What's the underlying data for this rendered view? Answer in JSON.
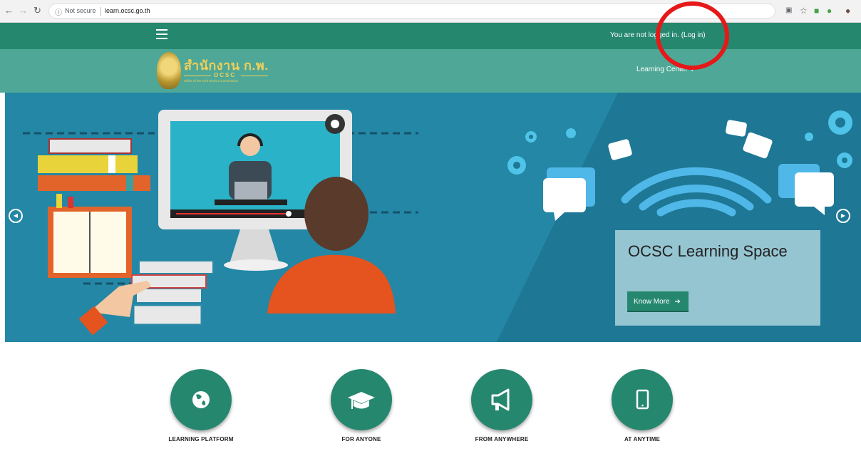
{
  "browser": {
    "back_icon": "arrow-left-icon",
    "forward_icon": "arrow-right-icon",
    "reload_icon": "reload-icon",
    "security_label": "Not secure",
    "url": "learn.ocsc.go.th"
  },
  "topbar": {
    "login_text": "You are not logged in. (",
    "login_link": "Log in",
    "login_close": ")"
  },
  "header": {
    "logo_thai": "สำนักงาน ก.พ.",
    "logo_ocsc": "OCSC",
    "logo_sub": "Office of the Civil Service Commission",
    "learning_center": "Learning Center"
  },
  "carousel": {
    "caption_title": "OCSC Learning Space",
    "know_more": "Know More"
  },
  "features": [
    {
      "label": "LEARNING PLATFORM",
      "icon": "globe-icon"
    },
    {
      "label": "FOR ANYONE",
      "icon": "graduation-cap-icon"
    },
    {
      "label": "FROM ANYWHERE",
      "icon": "megaphone-icon"
    },
    {
      "label": "AT ANYTIME",
      "icon": "mobile-phone-icon"
    }
  ],
  "colors": {
    "topbar": "#26876f",
    "header": "#4fa897",
    "carousel": "#1f7f9c",
    "accent": "#26876f",
    "annotation": "#e51919"
  }
}
